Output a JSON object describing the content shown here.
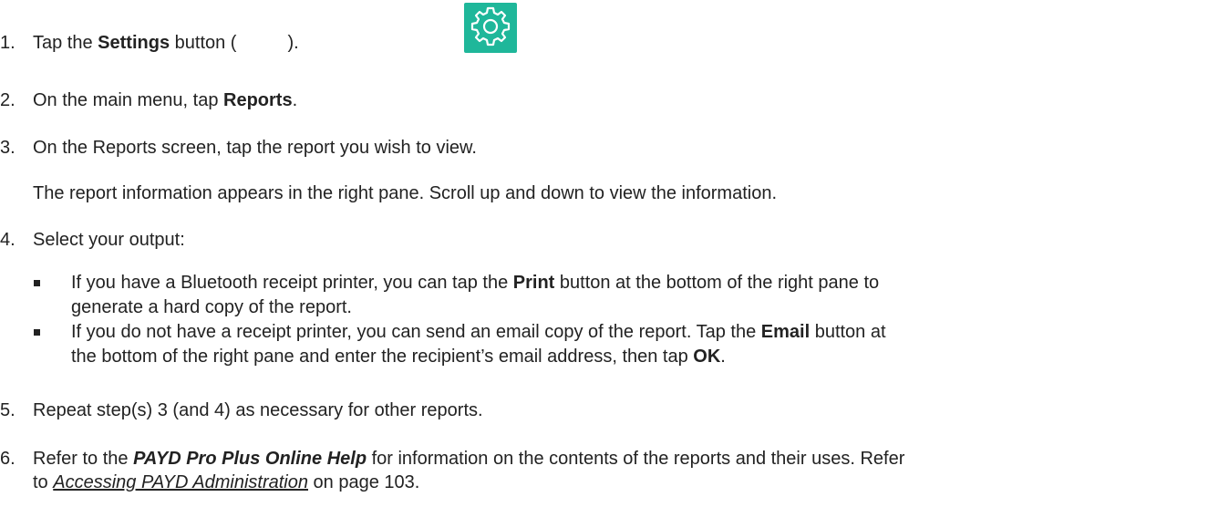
{
  "icons": {
    "settings": "gear-icon"
  },
  "colors": {
    "settings_icon_bg": "#1fb79a",
    "text": "#222222"
  },
  "steps": [
    {
      "number": "1.",
      "parts": [
        "Tap the ",
        "Settings",
        " button (",
        ")."
      ]
    },
    {
      "number": "2.",
      "parts": [
        "On the main menu, tap ",
        "Reports",
        "."
      ]
    },
    {
      "number": "3.",
      "parts": [
        "On the Reports screen, tap the report you wish to view."
      ],
      "note": "The report information appears in the right pane. Scroll up and down to view the information."
    },
    {
      "number": "4.",
      "parts": [
        "Select your output:"
      ],
      "bullets": [
        {
          "line1": [
            "If you have a Bluetooth receipt printer, you can tap the ",
            "Print",
            " button at the bottom of the right pane to"
          ],
          "line2": [
            "generate a hard copy of the report."
          ]
        },
        {
          "line1": [
            "If you do not have a receipt printer, you can send an email copy of the report. Tap the ",
            "Email",
            " button at"
          ],
          "line2": [
            "the bottom of the right pane and enter the recipient’s email address, then tap ",
            "OK",
            "."
          ]
        }
      ]
    },
    {
      "number": "5.",
      "parts": [
        "Repeat step(s) 3 (and 4) as necessary for other reports."
      ]
    },
    {
      "number": "6.",
      "line1": [
        "Refer to the ",
        "PAYD Pro Plus Online Help",
        " for information on the contents of the reports and their uses. Refer"
      ],
      "line2": [
        "to ",
        "Accessing PAYD Administration",
        " on page 103."
      ]
    }
  ]
}
